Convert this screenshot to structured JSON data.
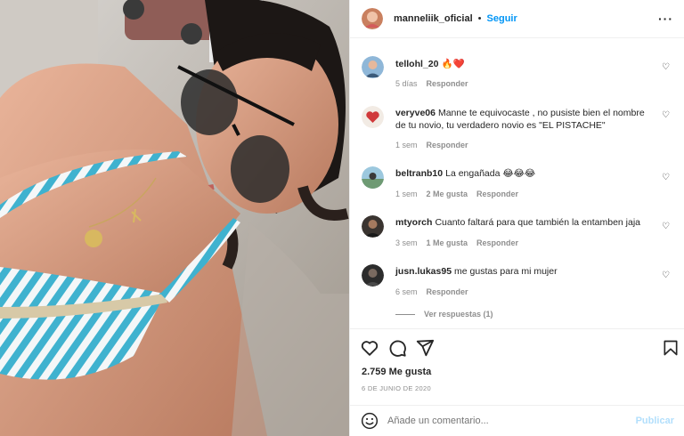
{
  "post": {
    "username": "manneliik_oficial",
    "separator": "•",
    "follow_label": "Seguir",
    "more_label": "···"
  },
  "comments": [
    {
      "user": "tellohl_20",
      "text": "🔥❤️",
      "time": "5 días",
      "likes": "",
      "reply": "Responder"
    },
    {
      "user": "veryve06",
      "text": "Manne te equivocaste , no pusiste bien el nombre de tu novio, tu verdadero novio es \"EL PISTACHE\"",
      "time": "1 sem",
      "likes": "",
      "reply": "Responder"
    },
    {
      "user": "beltranb10",
      "text": "La engañada 😂😂😂",
      "time": "1 sem",
      "likes": "2 Me gusta",
      "reply": "Responder"
    },
    {
      "user": "mtyorch",
      "text": "Cuanto faltará para que también la entamben jaja",
      "time": "3 sem",
      "likes": "1 Me gusta",
      "reply": "Responder"
    },
    {
      "user": "jusn.lukas95",
      "text": "me gustas para mi mujer",
      "time": "6 sem",
      "likes": "",
      "reply": "Responder"
    }
  ],
  "view_replies": "Ver respuestas (1)",
  "likes_count": "2.759 Me gusta",
  "date": "6 DE JUNIO DE 2020",
  "add_comment": {
    "placeholder": "Añade un comentario...",
    "publish": "Publicar"
  },
  "icons": {
    "like": "heart-icon",
    "comment": "comment-icon",
    "share": "share-icon",
    "save": "bookmark-icon",
    "emoji": "emoji-icon"
  },
  "colors": {
    "link": "#0095f6",
    "publish_disabled": "#b2dffc",
    "muted": "#8e8e8e"
  }
}
